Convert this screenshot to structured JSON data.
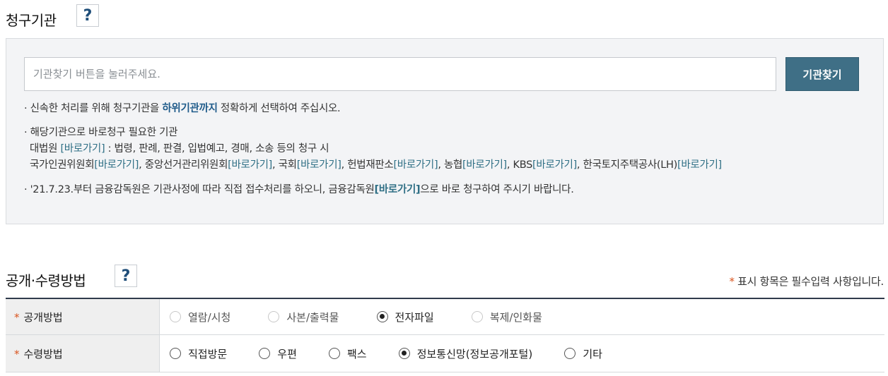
{
  "agency_section": {
    "title": "청구기관",
    "help_label": "?",
    "search_placeholder": "기관찾기 버튼을 눌러주세요.",
    "search_button": "기관찾기",
    "note1": {
      "prefix": "· 신속한 처리를 위해 청구기관을 ",
      "strong": "하위기관까지",
      "suffix": " 정확하게 선택하여 주십시오."
    },
    "note2": {
      "heading": "· 해당기관으로 바로청구 필요한 기관",
      "line1_prefix": "대법원 ",
      "line1_link": "[바로가기]",
      "line1_suffix": " : 법령, 판례, 판결, 입법예고, 경매, 소송 등의 청구 시",
      "orgs": [
        {
          "name": "국가인권위원회",
          "link": "[바로가기]",
          "sep": ", "
        },
        {
          "name": "중앙선거관리위원회",
          "link": "[바로가기]",
          "sep": ", "
        },
        {
          "name": "국회",
          "link": "[바로가기]",
          "sep": ", "
        },
        {
          "name": "헌법재판소",
          "link": "[바로가기]",
          "sep": ", "
        },
        {
          "name": "농협",
          "link": "[바로가기]",
          "sep": ", "
        },
        {
          "name": "KBS",
          "link": "[바로가기]",
          "sep": ", "
        },
        {
          "name": "한국토지주택공사(LH)",
          "link": "[바로가기]",
          "sep": ""
        }
      ]
    },
    "note3": {
      "prefix": "· '21.7.23.부터 금융감독원은 기관사정에 따라 직접 접수처리를 하오니, 금융감독원",
      "link": "[바로가기]",
      "suffix": "으로 바로 청구하여 주시기 바랍니다."
    }
  },
  "disclosure_section": {
    "title": "공개·수령방법",
    "help_label": "?",
    "required_star": "*",
    "required_note": " 표시 항목은 필수입력 사항입니다.",
    "rows": [
      {
        "label": "공개방법",
        "options": [
          {
            "label": "열람/시청",
            "checked": false,
            "disabled": true
          },
          {
            "label": "사본/출력물",
            "checked": false,
            "disabled": true
          },
          {
            "label": "전자파일",
            "checked": true,
            "disabled": false
          },
          {
            "label": "복제/인화물",
            "checked": false,
            "disabled": true
          }
        ]
      },
      {
        "label": "수령방법",
        "options": [
          {
            "label": "직접방문",
            "checked": false,
            "disabled": false
          },
          {
            "label": "우편",
            "checked": false,
            "disabled": false
          },
          {
            "label": "팩스",
            "checked": false,
            "disabled": false
          },
          {
            "label": "정보통신망(정보공개포털)",
            "checked": true,
            "disabled": false
          },
          {
            "label": "기타",
            "checked": false,
            "disabled": false
          }
        ]
      }
    ]
  },
  "colors": {
    "accent": "#3f6f86",
    "link": "#2f6f85",
    "required": "#d9541e",
    "panel_bg": "#f3f4f6"
  }
}
